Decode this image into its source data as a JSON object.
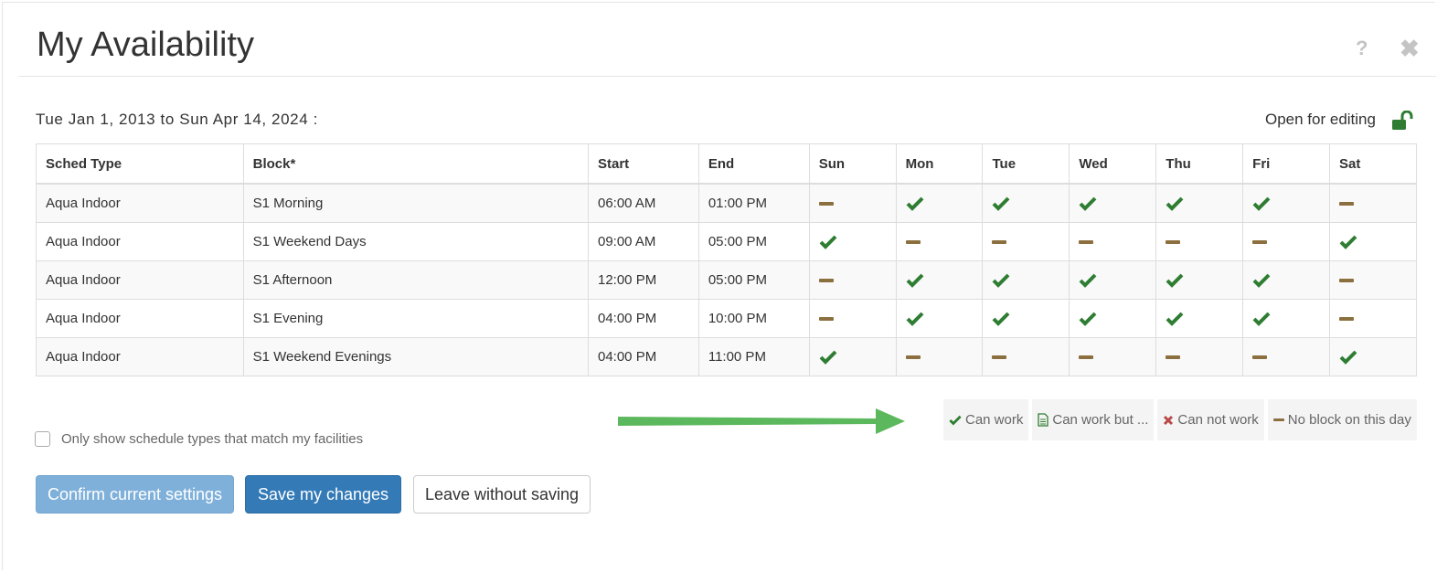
{
  "dialog": {
    "title": "My Availability",
    "help_icon": "question-icon",
    "close_icon": "close-icon"
  },
  "period": {
    "range": "Tue Jan 1, 2013 to Sun Apr 14, 2024 :",
    "status": "Open for editing",
    "status_icon": "unlock-icon"
  },
  "table": {
    "headers": [
      "Sched Type",
      "Block*",
      "Start",
      "End",
      "Sun",
      "Mon",
      "Tue",
      "Wed",
      "Thu",
      "Fri",
      "Sat"
    ],
    "rows": [
      {
        "sched_type": "Aqua Indoor",
        "block": "S1 Morning",
        "start": "06:00 AM",
        "end": "01:00 PM",
        "days": [
          "none",
          "can",
          "can",
          "can",
          "can",
          "can",
          "none"
        ]
      },
      {
        "sched_type": "Aqua Indoor",
        "block": "S1 Weekend Days",
        "start": "09:00 AM",
        "end": "05:00 PM",
        "days": [
          "can",
          "none",
          "none",
          "none",
          "none",
          "none",
          "can"
        ]
      },
      {
        "sched_type": "Aqua Indoor",
        "block": "S1 Afternoon",
        "start": "12:00 PM",
        "end": "05:00 PM",
        "days": [
          "none",
          "can",
          "can",
          "can",
          "can",
          "can",
          "none"
        ]
      },
      {
        "sched_type": "Aqua Indoor",
        "block": "S1 Evening",
        "start": "04:00 PM",
        "end": "10:00 PM",
        "days": [
          "none",
          "can",
          "can",
          "can",
          "can",
          "can",
          "none"
        ]
      },
      {
        "sched_type": "Aqua Indoor",
        "block": "S1 Weekend Evenings",
        "start": "04:00 PM",
        "end": "11:00 PM",
        "days": [
          "can",
          "none",
          "none",
          "none",
          "none",
          "none",
          "can"
        ]
      }
    ]
  },
  "legend": [
    {
      "icon": "check-icon",
      "label": "Can work"
    },
    {
      "icon": "document-icon",
      "label": "Can work but ..."
    },
    {
      "icon": "x-icon",
      "label": "Can not work"
    },
    {
      "icon": "dash-icon",
      "label": "No block on this day"
    }
  ],
  "filter": {
    "label": "Only show schedule types that match my facilities",
    "checked": false
  },
  "buttons": {
    "confirm": "Confirm current settings",
    "save": "Save my changes",
    "leave": "Leave without saving"
  },
  "colors": {
    "check": "#2e7d32",
    "dash": "#8b6f3e",
    "x": "#b94a48",
    "primary": "#337ab7",
    "primary_light": "#7fb0d9",
    "arrow": "#5cb85c"
  }
}
